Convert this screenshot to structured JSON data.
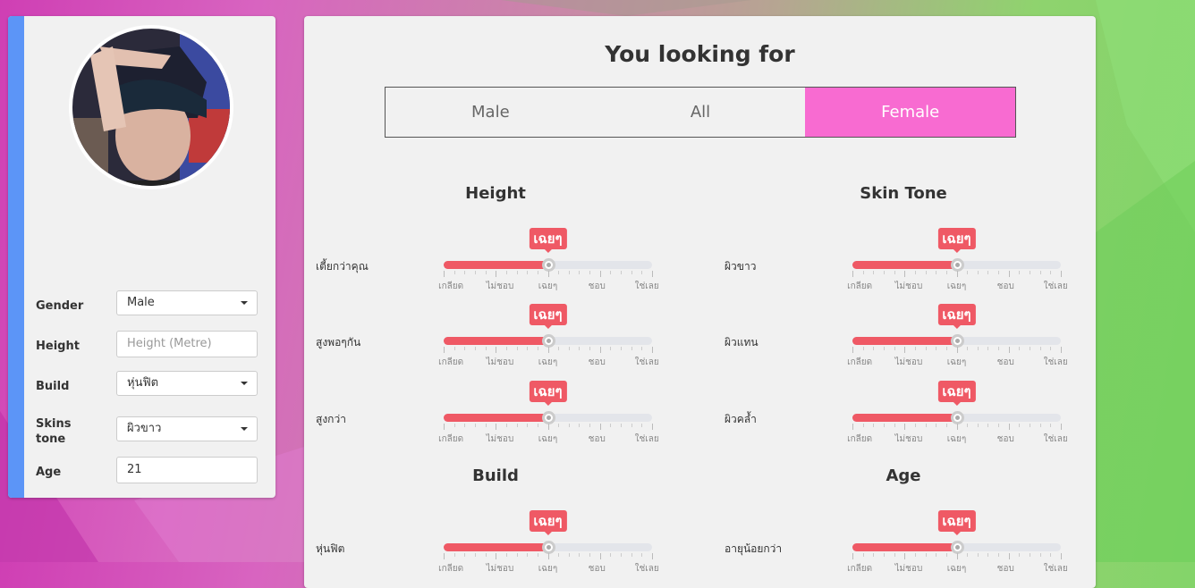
{
  "profile": {
    "fields": [
      {
        "label": "Gender",
        "value": "Male",
        "type": "select"
      },
      {
        "label": "Height",
        "placeholder": "Height (Metre)",
        "type": "input"
      },
      {
        "label": "Build",
        "value": "หุ่นฟิต",
        "type": "select"
      },
      {
        "label": "Skins\ntone",
        "value": "ผิวขาว",
        "type": "select"
      },
      {
        "label": "Age",
        "value": "21",
        "type": "input"
      }
    ]
  },
  "main": {
    "title": "You looking for",
    "gender_options": [
      "Male",
      "All",
      "Female"
    ],
    "selected_gender": "Female"
  },
  "scale_labels": [
    "เกลียด",
    "ไม่ชอบ",
    "เฉยๆ",
    "ชอบ",
    "ใช่เลย"
  ],
  "sections": [
    {
      "title": "Height",
      "rows": [
        {
          "label": "เตี้ยกว่าคุณ",
          "value": 0.5,
          "value_label": "เฉยๆ"
        },
        {
          "label": "สูงพอๆกัน",
          "value": 0.5,
          "value_label": "เฉยๆ"
        },
        {
          "label": "สูงกว่า",
          "value": 0.5,
          "value_label": "เฉยๆ"
        }
      ]
    },
    {
      "title": "Skin Tone",
      "rows": [
        {
          "label": "ผิวขาว",
          "value": 0.5,
          "value_label": "เฉยๆ"
        },
        {
          "label": "ผิวแทน",
          "value": 0.5,
          "value_label": "เฉยๆ"
        },
        {
          "label": "ผิวคล้ำ",
          "value": 0.5,
          "value_label": "เฉยๆ"
        }
      ]
    },
    {
      "title": "Build",
      "rows": [
        {
          "label": "หุ่นฟิต",
          "value": 0.5,
          "value_label": "เฉยๆ"
        }
      ]
    },
    {
      "title": "Age",
      "rows": [
        {
          "label": "อายุน้อยกว่า",
          "value": 0.5,
          "value_label": "เฉยๆ"
        }
      ]
    }
  ],
  "colors": {
    "accent_blue": "#5c95f7",
    "active_pink": "#f86bd1",
    "slider_red": "#ef5965"
  }
}
